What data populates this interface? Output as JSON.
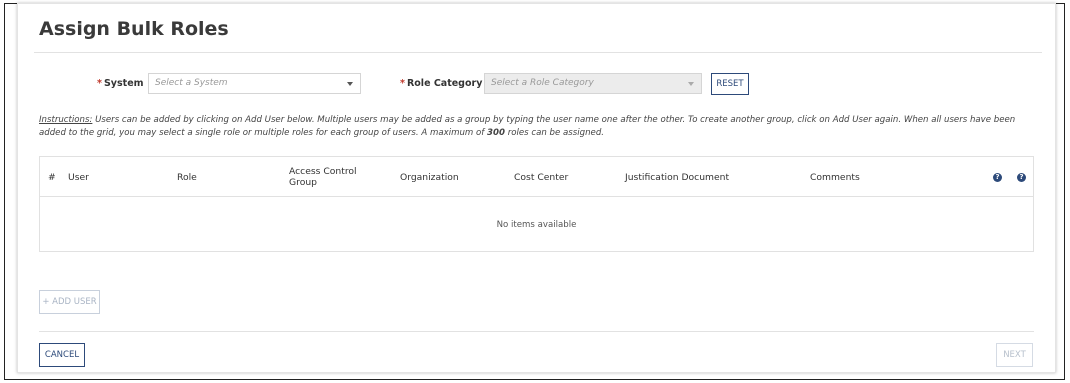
{
  "page": {
    "title": "Assign Bulk Roles"
  },
  "filters": {
    "system": {
      "required_mark": "*",
      "label": "System",
      "placeholder": "Select a System"
    },
    "role_category": {
      "required_mark": "*",
      "label": "Role Category",
      "placeholder": "Select a Role Category",
      "disabled": true
    },
    "reset_label": "RESET"
  },
  "instructions": {
    "lead": "Instructions:",
    "text_before": " Users can be added by clicking on Add User below. Multiple users may be added as a group by typing the user name one after the other. To create another group, click on Add User again. When all users have been added to the grid, you may select a single role or multiple roles for each group of users. A maximum of ",
    "max_roles": "300",
    "text_after": " roles can be assigned."
  },
  "grid": {
    "columns": {
      "num": "#",
      "user": "User",
      "role": "Role",
      "access_control_group": "Access Control Group",
      "organization": "Organization",
      "cost_center": "Cost Center",
      "justification_document": "Justification Document",
      "comments": "Comments"
    },
    "help_icon_glyph": "?",
    "empty_message": "No items available"
  },
  "actions": {
    "add_user_label": "+ ADD USER",
    "cancel_label": "CANCEL",
    "next_label": "NEXT"
  },
  "icons": {
    "help_1": "help-icon",
    "help_2": "help-icon",
    "system_dropdown": "caret-down-icon",
    "role_category_dropdown": "caret-down-icon"
  },
  "colors": {
    "accent": "#2d4a7a",
    "required": "#c0392b",
    "disabled_bg": "#ececec",
    "disabled_text": "#a9b4c4"
  }
}
